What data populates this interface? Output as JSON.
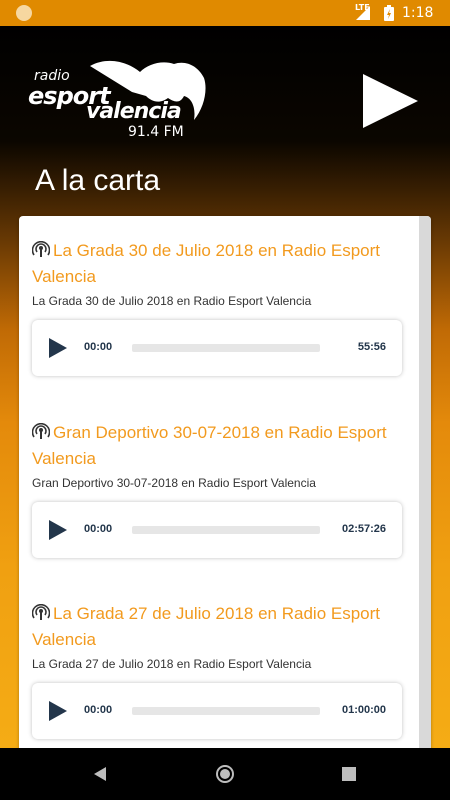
{
  "status_bar": {
    "network": "LTE",
    "time": "1:18"
  },
  "header": {
    "logo_text_radio": "radio",
    "logo_text_esport": "esport",
    "logo_text_valencia": "valencia",
    "logo_text_freq": "91.4 FM",
    "page_title": "A la carta"
  },
  "episodes": [
    {
      "title": "La Grada 30 de Julio 2018 en Radio Esport Valencia",
      "subtitle": "La Grada 30 de Julio 2018 en Radio Esport Valencia",
      "current_time": "00:00",
      "duration": "55:56"
    },
    {
      "title": "Gran Deportivo 30-07-2018 en Radio Esport Valencia",
      "subtitle": "Gran Deportivo 30-07-2018 en Radio Esport Valencia",
      "current_time": "00:00",
      "duration": "02:57:26"
    },
    {
      "title": "La Grada 27 de Julio 2018 en Radio Esport Valencia",
      "subtitle": "La Grada 27 de Julio 2018 en Radio Esport Valencia",
      "current_time": "00:00",
      "duration": "01:00:00"
    }
  ],
  "icons": {
    "play_big": "play-icon",
    "podcast": "podcast-icon",
    "nav_back": "back-icon",
    "nav_home": "home-icon",
    "nav_recents": "recents-icon"
  },
  "colors": {
    "status_bar": "#e08a00",
    "accent_title": "#f29a1e",
    "player_text": "#23364b"
  }
}
